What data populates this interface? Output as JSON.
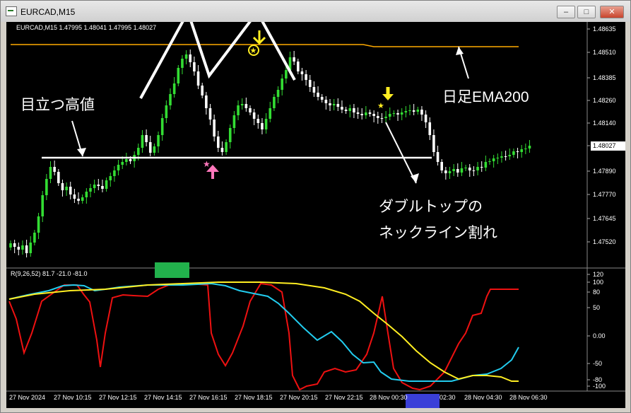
{
  "window": {
    "title": "EURCAD,M15",
    "min_label": "–",
    "max_label": "□",
    "close_label": "✕"
  },
  "chart": {
    "symbol_info": "EURCAD,M15  1.47995 1.48041 1.47995 1.48027",
    "indicator_info": "R(9,26,52) 81.7 -21.0 -81.0",
    "current_price": "1.48027",
    "price_labels": [
      "1.48635",
      "1.48510",
      "1.48385",
      "1.48260",
      "1.48140",
      "1.48015",
      "1.47890",
      "1.47770",
      "1.47645",
      "1.47520"
    ],
    "ind_labels": [
      "120",
      "100",
      "80",
      "50",
      "0.00",
      "-50",
      "-80",
      "-100"
    ],
    "time_labels": [
      "27 Nov 2024",
      "27 Nov 10:15",
      "27 Nov 12:15",
      "27 Nov 14:15",
      "27 Nov 16:15",
      "27 Nov 18:15",
      "27 Nov 20:15",
      "27 Nov 22:15",
      "28 Nov 00:30",
      "02:30",
      "28 Nov 04:30",
      "28 Nov 06:30"
    ],
    "colors": {
      "up": "#33dd33",
      "down": "#ffffff",
      "ema": "#ffaa00",
      "red": "#ee1111",
      "cyan": "#22ccee",
      "yellow": "#ffee22",
      "green_box": "#22b14c",
      "blue_box": "#3a3fd8"
    }
  },
  "annotations": {
    "high": "目立つ高値",
    "ema": "日足EMA200",
    "dtop_line1": "ダブルトップの",
    "dtop_line2": "ネックライン割れ"
  }
}
